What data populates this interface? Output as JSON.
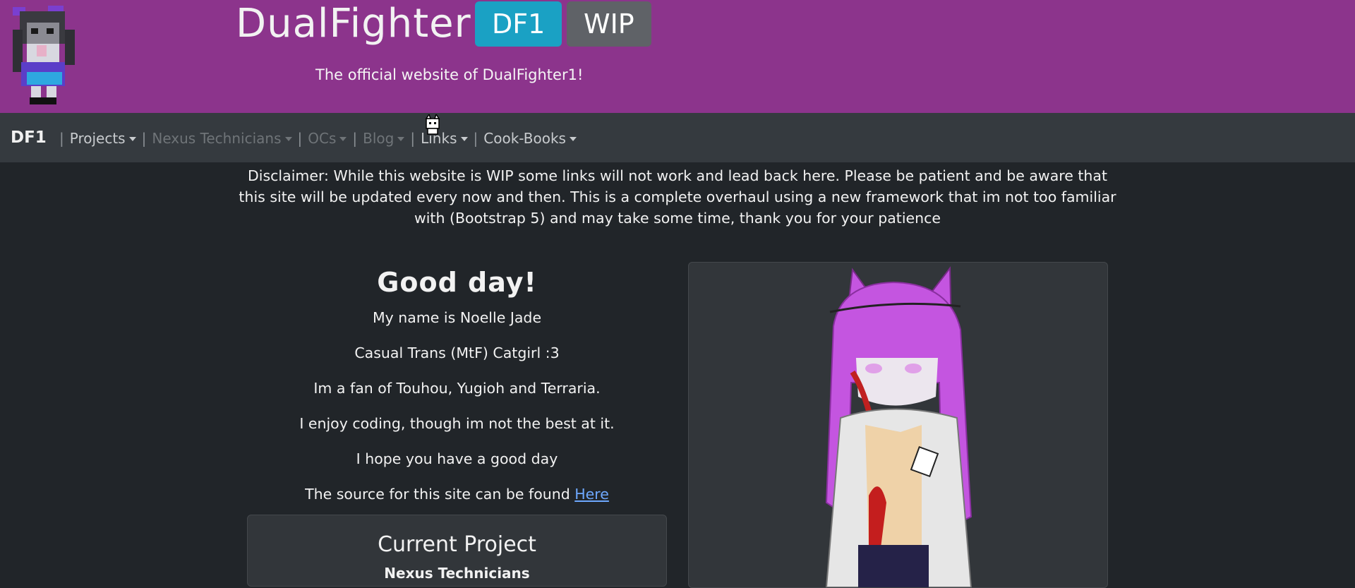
{
  "header": {
    "title": "DualFighter1",
    "badges": {
      "df1": "DF1",
      "wip": "WIP"
    },
    "tagline": "The official website of DualFighter1!"
  },
  "nav": {
    "brand": "DF1",
    "items": [
      {
        "label": "Projects",
        "state": "enabled"
      },
      {
        "label": "Nexus Technicians",
        "state": "disabled"
      },
      {
        "label": "OCs",
        "state": "disabled"
      },
      {
        "label": "Blog",
        "state": "disabled"
      },
      {
        "label": "Links",
        "state": "enabled"
      },
      {
        "label": "Cook-Books",
        "state": "enabled"
      }
    ]
  },
  "disclaimer": "Disclaimer: While this website is WIP some links will not work and lead back here. Please be patient and be aware that this site will be updated every now and then. This is a complete overhaul using a new framework that im not too familiar with (Bootstrap 5) and may take some time, thank you for your patience",
  "intro": {
    "greeting": "Good day!",
    "lines": [
      "My name is Noelle Jade",
      "Casual Trans (MtF) Catgirl :3",
      "Im a fan of Touhou, Yugioh and Terraria.",
      "I enjoy coding, though im not the best at it.",
      "I hope you have a good day"
    ],
    "source_text": "The source for this site can be found ",
    "source_link": "Here"
  },
  "current_project": {
    "title": "Current Project",
    "name": "Nexus Technicians"
  },
  "colors": {
    "header_bg": "#8c348c",
    "nav_bg": "#353a3f",
    "page_bg": "#212529",
    "badge_df1": "#1aa1c4",
    "badge_wip": "#5f6267",
    "link": "#6ea8fe"
  }
}
